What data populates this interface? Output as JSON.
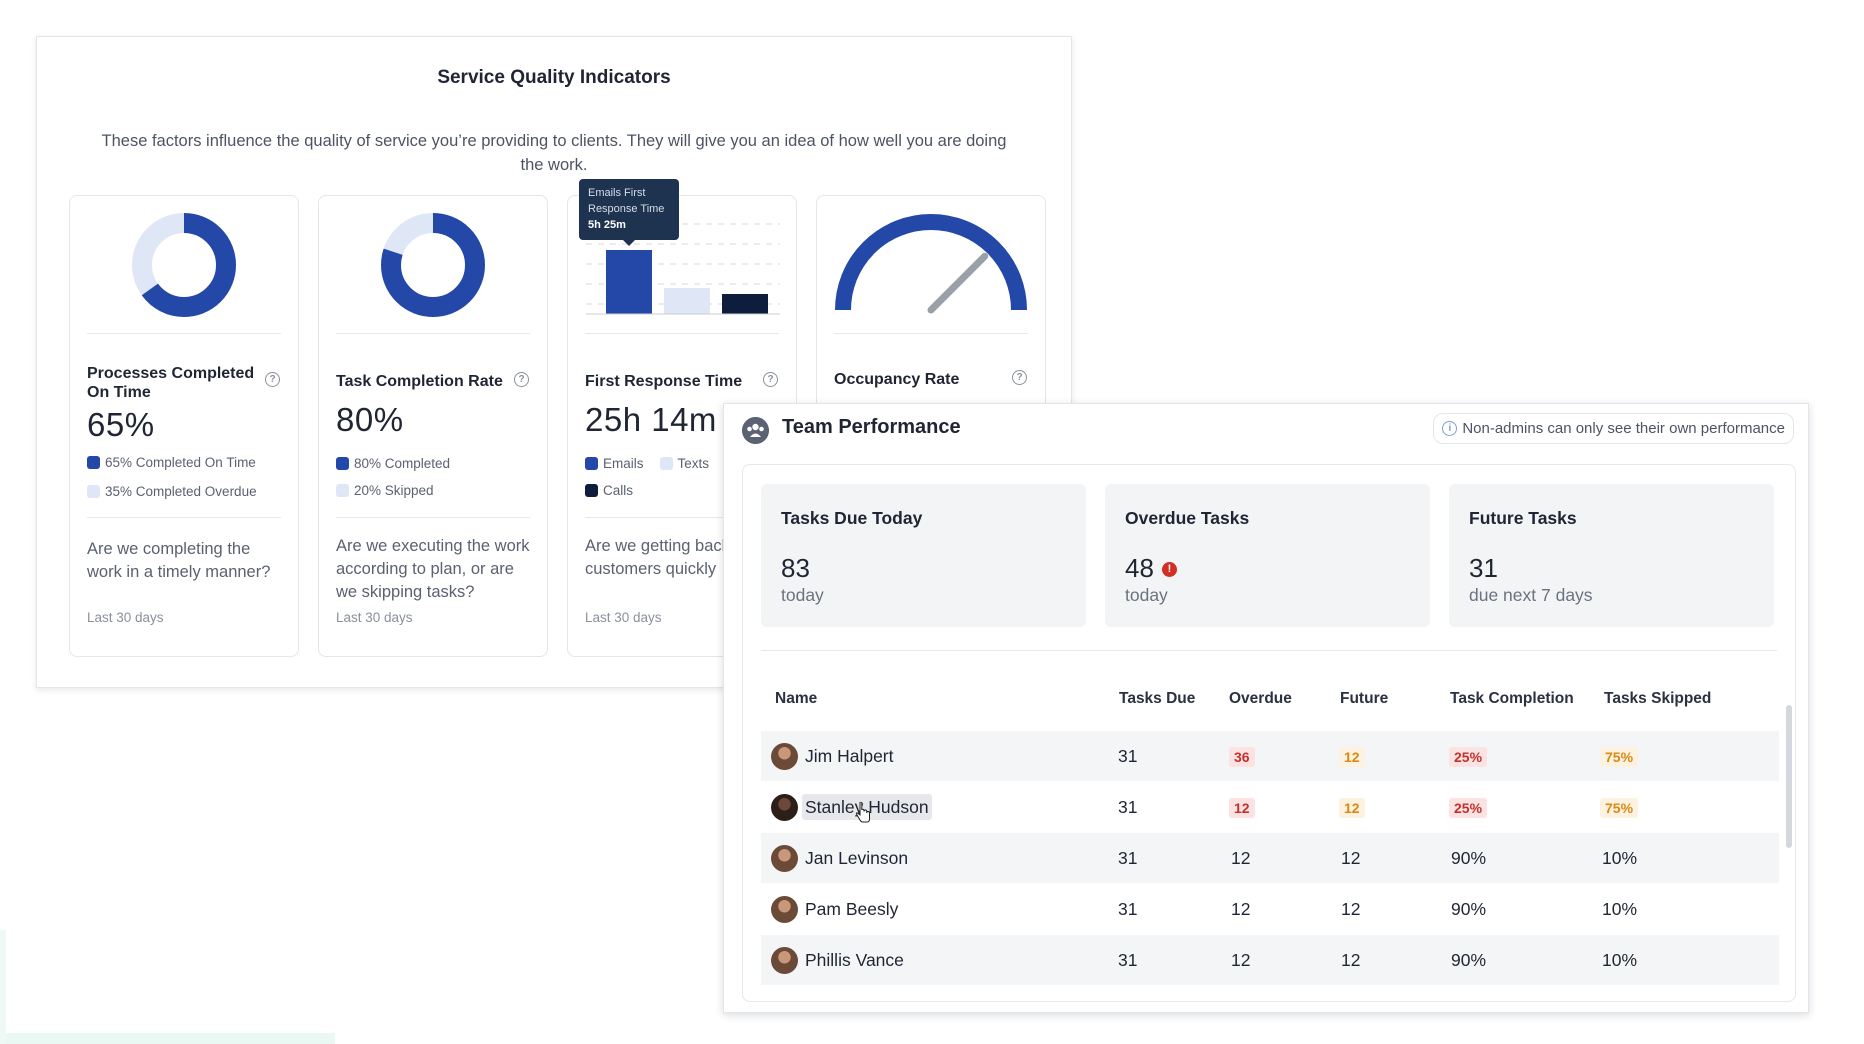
{
  "service_quality": {
    "title": "Service Quality Indicators",
    "description": "These factors influence the quality of service you’re providing to clients. They will give you an idea of how well you are doing the work.",
    "cards": [
      {
        "name": "Processes Completed On Time",
        "value": "65%",
        "chart": "donut",
        "fraction": 0.65,
        "legend": [
          "65% Completed On Time",
          "35% Completed Overdue"
        ],
        "question": "Are we completing the work in a timely manner?",
        "period": "Last 30 days"
      },
      {
        "name": "Task Completion Rate",
        "value": "80%",
        "chart": "donut",
        "fraction": 0.8,
        "legend": [
          "80% Completed",
          "20% Skipped"
        ],
        "question": "Are we executing the work according to plan, or are we skipping tasks?",
        "period": "Last 30 days"
      },
      {
        "name": "First Response Time",
        "value": "25h 14m",
        "chart": "bar",
        "legend": [
          "Emails",
          "Texts",
          "Calls"
        ],
        "tooltip": {
          "line1": "Emails First",
          "line2": "Response Time",
          "value": "5h 25m"
        },
        "question": "Are we getting back to customers quickly",
        "period": "Last 30 days"
      },
      {
        "name": "Occupancy Rate",
        "chart": "gauge",
        "level": 0.75
      }
    ],
    "help_glyph": "?"
  },
  "team_performance": {
    "title": "Team Performance",
    "notice": "Non-admins can only see their own performance",
    "stats": [
      {
        "label": "Tasks Due Today",
        "value": "83",
        "sub": "today"
      },
      {
        "label": "Overdue Tasks",
        "value": "48",
        "sub": "today",
        "alert": "!"
      },
      {
        "label": "Future Tasks",
        "value": "31",
        "sub": "due next 7 days"
      }
    ],
    "columns": [
      "Name",
      "Tasks Due",
      "Overdue",
      "Future",
      "Task Completion",
      "Tasks Skipped"
    ],
    "rows": [
      {
        "name": "Jim Halpert",
        "due": "31",
        "overdue": "36",
        "future": "12",
        "completion": "25%",
        "skipped": "75%"
      },
      {
        "name": "Stanley Hudson",
        "due": "31",
        "overdue": "12",
        "future": "12",
        "completion": "25%",
        "skipped": "75%"
      },
      {
        "name": "Jan Levinson",
        "due": "31",
        "overdue": "12",
        "future": "12",
        "completion": "90%",
        "skipped": "10%"
      },
      {
        "name": "Pam Beesly",
        "due": "31",
        "overdue": "12",
        "future": "12",
        "completion": "90%",
        "skipped": "10%"
      },
      {
        "name": "Phillis Vance",
        "due": "31",
        "overdue": "12",
        "future": "12",
        "completion": "90%",
        "skipped": "10%"
      }
    ]
  },
  "colors": {
    "primary_blue": "#2448a8",
    "light_blue": "#dfe6f6",
    "navy": "#0f1d3d",
    "alert_red": "#d22f27",
    "warn_orange": "#d98a16"
  },
  "icons": [
    "help-icon",
    "team-icon",
    "info-icon",
    "alert-icon",
    "avatar",
    "pointer-cursor-icon"
  ]
}
